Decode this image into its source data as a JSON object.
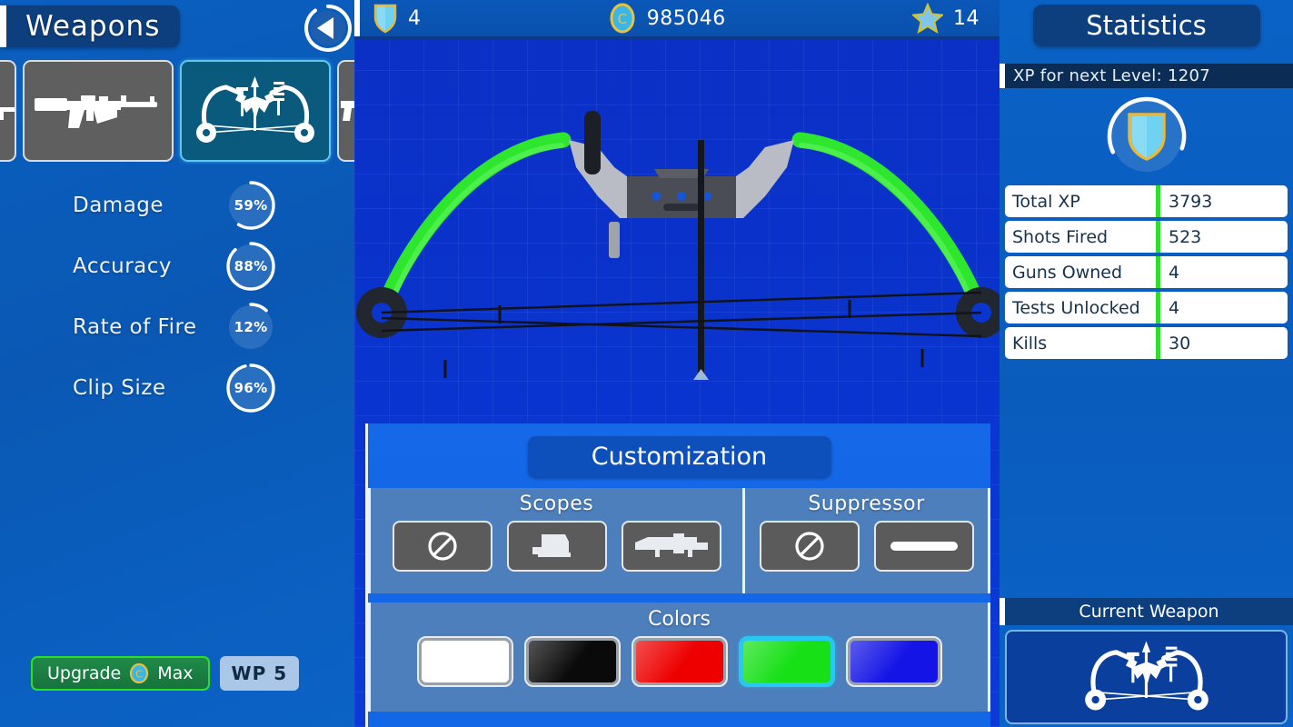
{
  "left": {
    "title": "Weapons",
    "back_icon": "back-arrow-icon",
    "weapon_tabs": [
      {
        "name": "weapon-tab-partial-left",
        "icon": "pistol-icon",
        "selected": false
      },
      {
        "name": "weapon-tab-ak47",
        "icon": "assault-rifle-icon",
        "selected": false
      },
      {
        "name": "weapon-tab-bow",
        "icon": "compound-bow-icon",
        "selected": true
      },
      {
        "name": "weapon-tab-partial-right",
        "icon": "pistol-icon",
        "selected": false
      }
    ],
    "stats": [
      {
        "label": "Damage",
        "value": "59%",
        "pct": 59
      },
      {
        "label": "Accuracy",
        "value": "88%",
        "pct": 88
      },
      {
        "label": "Rate of Fire",
        "value": "12%",
        "pct": 12
      },
      {
        "label": "Clip Size",
        "value": "96%",
        "pct": 96
      }
    ],
    "upgrade": {
      "label_before": "Upgrade",
      "coin_icon": "coin-icon",
      "label_after": "Max"
    },
    "wp_badge": "WP 5"
  },
  "hud": {
    "shield": {
      "icon": "shield-icon",
      "value": "4"
    },
    "coins": {
      "icon": "coin-icon",
      "value": "985046"
    },
    "stars": {
      "icon": "star-icon",
      "value": "14"
    }
  },
  "stage": {
    "weapon_name": "compound-bow",
    "limb_color": "#2ee62e",
    "body_color": "#4a4a52"
  },
  "customization": {
    "title": "Customization",
    "scopes": {
      "label": "Scopes",
      "options": [
        {
          "name": "scope-option-none",
          "icon": "no-symbol-icon",
          "selected": false
        },
        {
          "name": "scope-option-reddot",
          "icon": "red-dot-sight-icon",
          "selected": false
        },
        {
          "name": "scope-option-scope",
          "icon": "telescopic-scope-icon",
          "selected": false
        }
      ]
    },
    "suppressor": {
      "label": "Suppressor",
      "options": [
        {
          "name": "suppressor-option-none",
          "icon": "no-symbol-icon",
          "selected": false
        },
        {
          "name": "suppressor-option-on",
          "icon": "suppressor-bar-icon",
          "selected": false
        }
      ]
    },
    "colors": {
      "label": "Colors",
      "swatches": [
        {
          "name": "color-swatch-white",
          "hex": "#ffffff",
          "selected": false
        },
        {
          "name": "color-swatch-black",
          "hex": "#0a0a0a",
          "selected": false
        },
        {
          "name": "color-swatch-red",
          "hex": "#ee0000",
          "selected": false
        },
        {
          "name": "color-swatch-green",
          "hex": "#17e017",
          "selected": true
        },
        {
          "name": "color-swatch-blue",
          "hex": "#1414e6",
          "selected": false
        }
      ]
    }
  },
  "right": {
    "title": "Statistics",
    "xp_next_level": "XP for next Level: 1207",
    "level_shield_icon": "shield-icon",
    "level_progress_pct": 62,
    "table": [
      {
        "key": "Total XP",
        "value": "3793"
      },
      {
        "key": "Shots Fired",
        "value": "523"
      },
      {
        "key": "Guns Owned",
        "value": "4"
      },
      {
        "key": "Tests Unlocked",
        "value": "4"
      },
      {
        "key": "Kills",
        "value": "30"
      }
    ],
    "current_weapon_title": "Current Weapon",
    "current_weapon_icon": "compound-bow-icon"
  },
  "colors": {
    "accent_green": "#2ce02c",
    "accent_cyan": "#28c8f0",
    "panel_blue": "#0a5cb8",
    "navy": "#0d3f7e"
  }
}
